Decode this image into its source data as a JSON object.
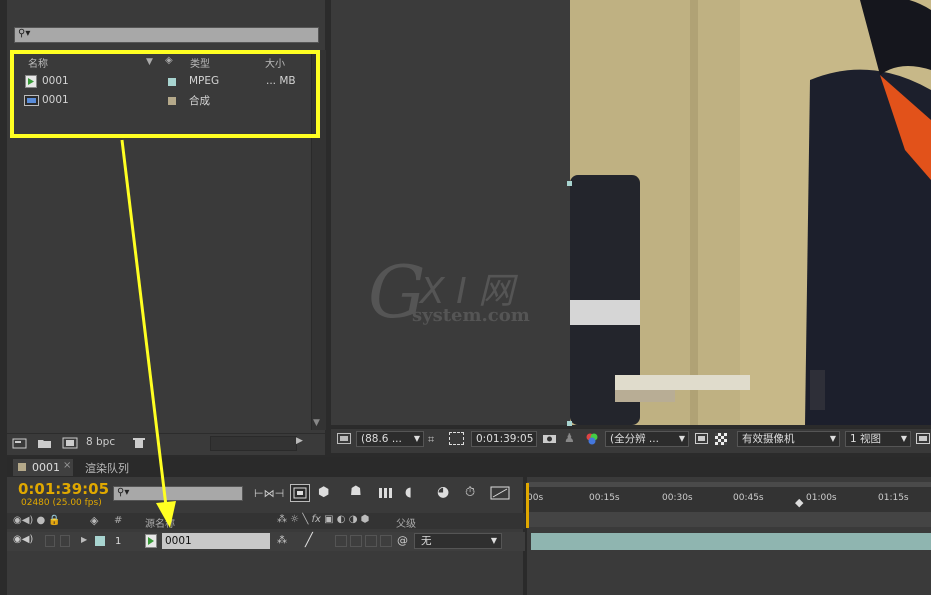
{
  "project_panel": {
    "search": {
      "value": "",
      "glyph": "⚲▾"
    },
    "columns": {
      "name": "名称",
      "type": "类型",
      "size": "大小"
    },
    "items": [
      {
        "name": "0001",
        "type": "MPEG",
        "size": "... MB",
        "icon": "footage-icon",
        "label_color": "#a8d4d0"
      },
      {
        "name": "0001",
        "type": "合成",
        "size": "",
        "icon": "composition-icon",
        "label_color": "#b5a98a"
      }
    ],
    "bpc": "8 bpc"
  },
  "viewer": {
    "watermark": {
      "brand": "G",
      "brand2": "X I 网",
      "sub": "system.com"
    },
    "toolbar": {
      "zoom": "(88.6 ...",
      "timecode": "0:01:39:05",
      "resolution": "(全分辨 ...",
      "camera": "有效摄像机",
      "views": "1 视图"
    }
  },
  "timeline": {
    "tabs": [
      {
        "label": "0001"
      },
      {
        "label": "渲染队列"
      }
    ],
    "timecode": "0:01:39:05",
    "frame_info": "02480 (25.00 fps)",
    "headers": {
      "number": "#",
      "source": "源名称",
      "parent": "父级"
    },
    "layer": {
      "index": "1",
      "name": "0001",
      "parent": "无"
    },
    "ruler_ticks": [
      "00s",
      "00:15s",
      "00:30s",
      "00:45s",
      "01:00s",
      "01:15s"
    ],
    "colors": {
      "timecode": "#e0a800",
      "layer_bar": "#8fb5b0",
      "highlight": "#ffff22"
    }
  }
}
